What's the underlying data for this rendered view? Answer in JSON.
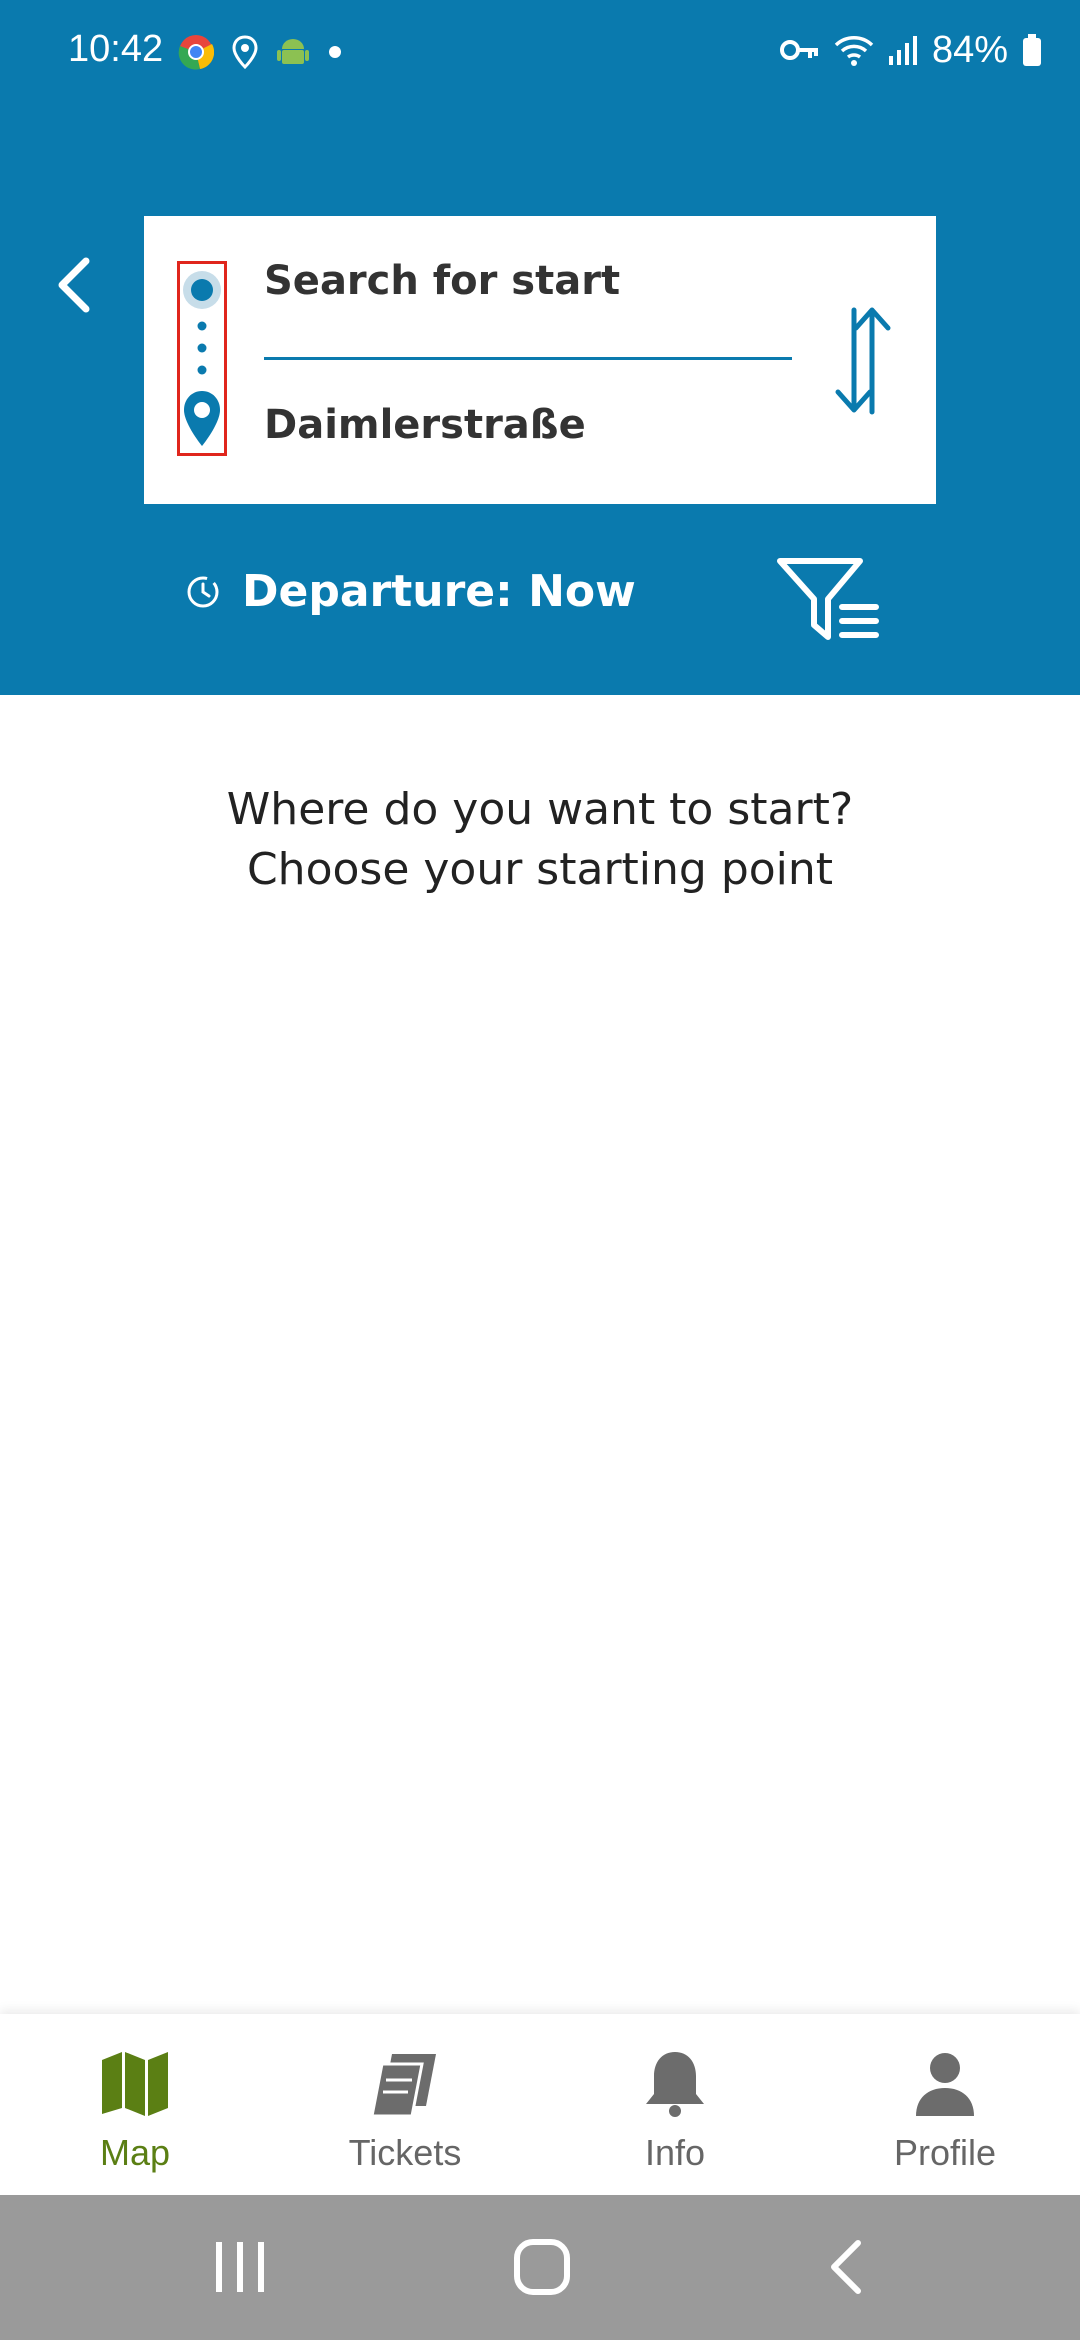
{
  "status_bar": {
    "time": "10:42",
    "battery": "84%",
    "icons_left": [
      "chrome-icon",
      "location-icon",
      "android-icon",
      "dot-icon"
    ],
    "icons_right": [
      "vpn-key-icon",
      "wifi-icon",
      "signal-icon",
      "battery-icon"
    ]
  },
  "search": {
    "start_placeholder": "Search for start",
    "destination_value": "Daimlerstraße"
  },
  "departure": {
    "label": "Departure: Now"
  },
  "prompt": {
    "line1": "Where do you want to start?",
    "line2": "Choose your starting point"
  },
  "bottom_nav": {
    "items": [
      {
        "label": "Map",
        "icon": "map-icon",
        "active": true
      },
      {
        "label": "Tickets",
        "icon": "tickets-icon",
        "active": false
      },
      {
        "label": "Info",
        "icon": "bell-icon",
        "active": false
      },
      {
        "label": "Profile",
        "icon": "profile-icon",
        "active": false
      }
    ]
  },
  "colors": {
    "header": "#0a7aae",
    "accent_active": "#5b7f14",
    "marker_outline": "#e0261d",
    "system_nav": "#9a9a9a"
  }
}
